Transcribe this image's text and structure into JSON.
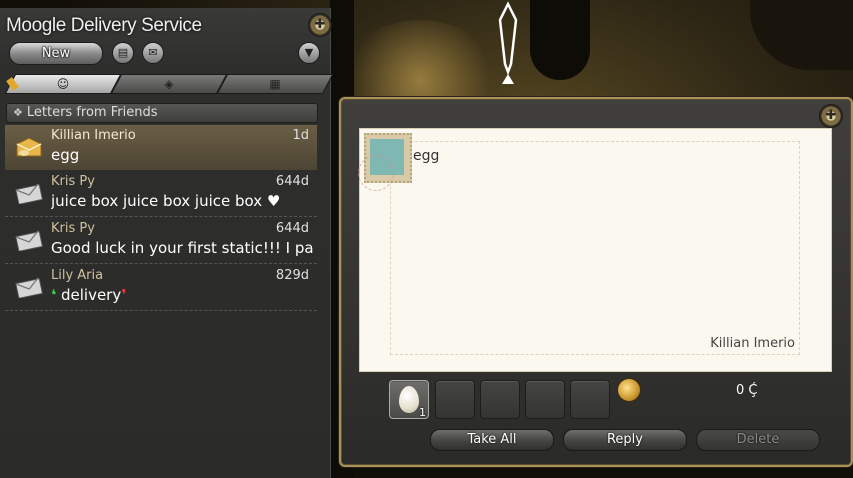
{
  "window": {
    "title": "Moogle Delivery Service",
    "new_label": "New"
  },
  "tabs": [
    {
      "name": "friends",
      "icon": "smiley-icon",
      "active": true
    },
    {
      "name": "packages",
      "icon": "box-icon",
      "active": false
    },
    {
      "name": "gm",
      "icon": "document-icon",
      "active": false
    }
  ],
  "section": {
    "title": "Letters from Friends"
  },
  "letters": [
    {
      "sender": "Killian Imerio",
      "age": "1d",
      "subject": "egg",
      "selected": true,
      "icon": "open-letter-gold-icon"
    },
    {
      "sender": "Kris Py",
      "age": "644d",
      "subject": "juice box juice box juice box ♥",
      "selected": false,
      "icon": "envelope-icon"
    },
    {
      "sender": "Kris Py",
      "age": "644d",
      "subject": "Good luck in your first static!!! I pac…",
      "selected": false,
      "icon": "envelope-icon"
    },
    {
      "sender": "Lily Aria",
      "age": "829d",
      "subject": "delivery",
      "selected": false,
      "icon": "envelope-icon",
      "quote_open": "❛",
      "quote_close": "❜"
    }
  ],
  "letter": {
    "body": "egg",
    "signature": "Killian Imerio",
    "attachments": [
      {
        "item": "egg",
        "quantity": "1"
      }
    ],
    "gil": "0 Ḉ",
    "take_all_label": "Take All",
    "reply_label": "Reply",
    "delete_label": "Delete"
  },
  "colors": {
    "accent_gold": "#a8925a",
    "selected_row": "#6b5e45",
    "quote_green": "#3fd14b",
    "quote_red": "#e23a3a"
  }
}
